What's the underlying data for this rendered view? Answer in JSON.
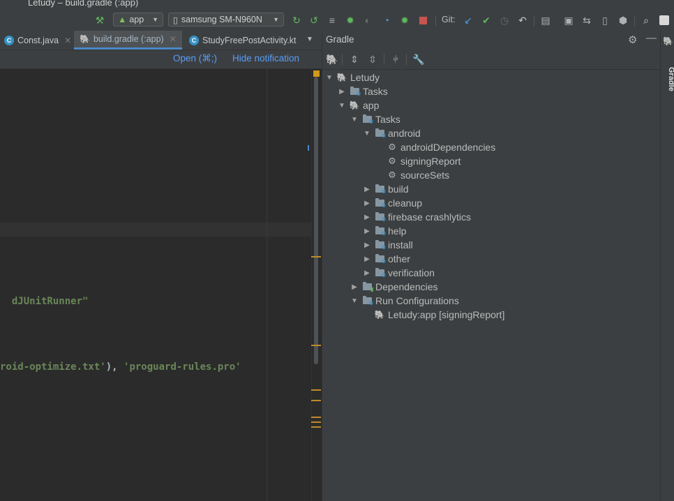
{
  "window": {
    "title": "Letudy – build.gradle (:app)"
  },
  "toolbar": {
    "config": "app",
    "device": "samsung SM-N960N",
    "git_label": "Git:"
  },
  "tabs": [
    {
      "label": "Const.java",
      "icon_color": "#3592c4"
    },
    {
      "label": "build.gradle (:app)",
      "icon_color": "#9ea4a8"
    },
    {
      "label": "StudyFreePostActivity.kt",
      "icon_color": "#3592c4"
    }
  ],
  "notification": {
    "open_label": "Open (⌘;)",
    "hide_label": "Hide notification"
  },
  "editor": {
    "line1": "dJUnitRunner\"",
    "line2_a": "roid-optimize.txt'",
    "line2_b": "), ",
    "line2_c": "'proguard-rules.pro'"
  },
  "gradle": {
    "title": "Gradle",
    "side_label": "Gradle",
    "tree": [
      {
        "label": "Letudy",
        "depth": 0,
        "expanded": true,
        "icon": "elephant-icon"
      },
      {
        "label": "Tasks",
        "depth": 1,
        "expanded": false,
        "icon": "task-folder-icon"
      },
      {
        "label": "app",
        "depth": 1,
        "expanded": true,
        "icon": "elephant-icon"
      },
      {
        "label": "Tasks",
        "depth": 2,
        "expanded": true,
        "icon": "task-folder-icon"
      },
      {
        "label": "android",
        "depth": 3,
        "expanded": true,
        "icon": "task-folder-icon"
      },
      {
        "label": "androidDependencies",
        "depth": 4,
        "leaf": true,
        "icon": "gear-icon"
      },
      {
        "label": "signingReport",
        "depth": 4,
        "leaf": true,
        "icon": "gear-icon"
      },
      {
        "label": "sourceSets",
        "depth": 4,
        "leaf": true,
        "icon": "gear-icon"
      },
      {
        "label": "build",
        "depth": 3,
        "expanded": false,
        "icon": "task-folder-icon"
      },
      {
        "label": "cleanup",
        "depth": 3,
        "expanded": false,
        "icon": "task-folder-icon"
      },
      {
        "label": "firebase crashlytics",
        "depth": 3,
        "expanded": false,
        "icon": "task-folder-icon"
      },
      {
        "label": "help",
        "depth": 3,
        "expanded": false,
        "icon": "task-folder-icon"
      },
      {
        "label": "install",
        "depth": 3,
        "expanded": false,
        "icon": "task-folder-icon"
      },
      {
        "label": "other",
        "depth": 3,
        "expanded": false,
        "icon": "task-folder-icon"
      },
      {
        "label": "verification",
        "depth": 3,
        "expanded": false,
        "icon": "task-folder-icon"
      },
      {
        "label": "Dependencies",
        "depth": 2,
        "expanded": false,
        "icon": "dependencies-icon"
      },
      {
        "label": "Run Configurations",
        "depth": 2,
        "expanded": true,
        "icon": "task-folder-icon"
      },
      {
        "label": "Letudy:app [signingReport]",
        "depth": 3,
        "leaf": true,
        "icon": "elephant-icon"
      }
    ]
  }
}
